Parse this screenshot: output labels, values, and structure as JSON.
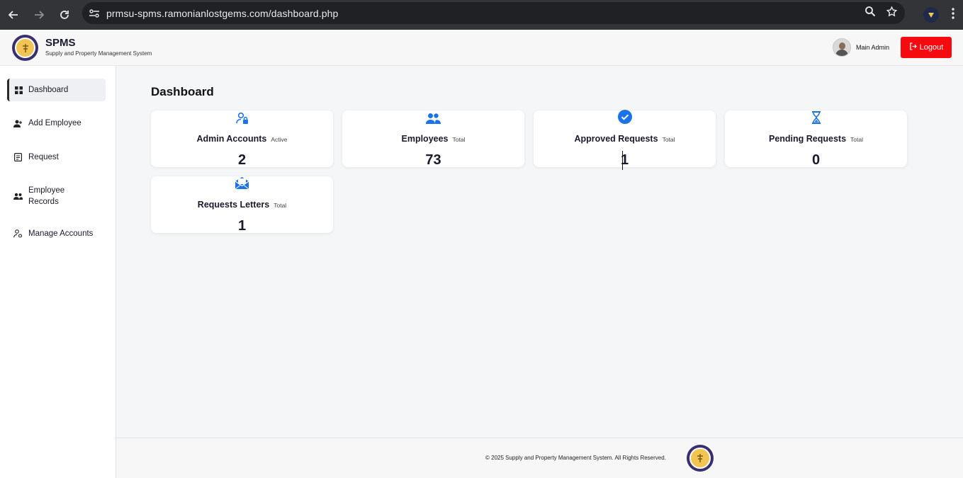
{
  "browser": {
    "url": "prmsu-spms.ramonianlostgems.com/dashboard.php",
    "icons": [
      "back-arrow-icon",
      "forward-arrow-icon",
      "reload-icon",
      "site-settings-icon",
      "zoom-icon",
      "star-icon",
      "extension-icon",
      "kebab-menu-icon"
    ]
  },
  "header": {
    "brand_title": "SPMS",
    "brand_subtitle": "Supply and Property Management System",
    "admin_name": "Main Admin",
    "logout_label": "Logout"
  },
  "sidebar": {
    "items": [
      {
        "label": "Dashboard",
        "icon": "grid-icon"
      },
      {
        "label": "Add Employee",
        "icon": "add-user-icon"
      },
      {
        "label": "Request",
        "icon": "request-icon"
      },
      {
        "label": "Employee Records",
        "icon": "users-icon"
      },
      {
        "label": "Manage Accounts",
        "icon": "user-gear-icon"
      }
    ]
  },
  "main": {
    "title": "Dashboard",
    "cards": [
      {
        "label": "Admin Accounts",
        "tag": "Active",
        "value": "2",
        "icon": "user-lock-icon"
      },
      {
        "label": "Employees",
        "tag": "Total",
        "value": "73",
        "icon": "users-icon"
      },
      {
        "label": "Approved Requests",
        "tag": "Total",
        "value": "1",
        "icon": "check-circle-icon"
      },
      {
        "label": "Pending Requests",
        "tag": "Total",
        "value": "0",
        "icon": "hourglass-icon"
      },
      {
        "label": "Requests Letters",
        "tag": "Total",
        "value": "1",
        "icon": "envelope-icon"
      }
    ]
  },
  "footer": {
    "text": "© 2025 Supply and Property Management System. All Rights Reserved."
  },
  "colors": {
    "accent": "#1a73e8",
    "logout": "#f50a10",
    "background": "#f5f6f8"
  }
}
